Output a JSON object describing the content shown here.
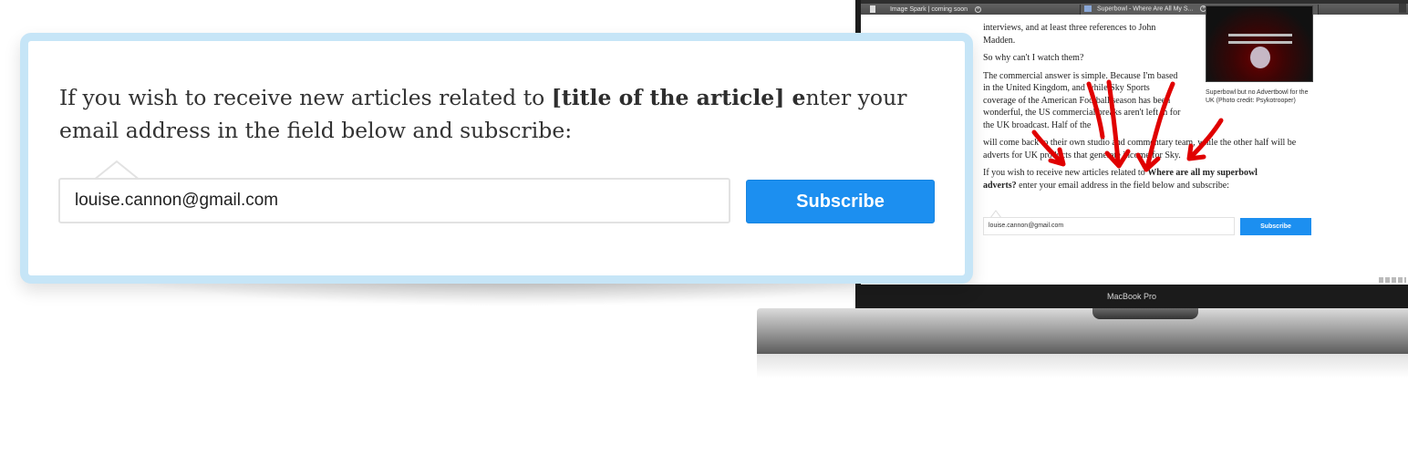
{
  "browser": {
    "tabs": [
      {
        "label": "Image Spark | coming soon"
      },
      {
        "label": "Superbowl - Where Are All My S..."
      }
    ]
  },
  "article": {
    "p1": "interviews, and at least three references to John Madden.",
    "p2": "So why can't I watch them?",
    "p3": "The commercial answer is simple. Because I'm based in the United Kingdom, and while Sky Sports coverage of the American Football season has been wonderful, the US commercial breaks aren't left in for the UK broadcast. Half of the",
    "p4": "will come back to their own studio and commentary team, while the other half will be adverts for UK products that generate income for Sky.",
    "subscribe_prefix": "If you wish to receive new articles related to ",
    "subscribe_title": "Where are all my superbowl adverts?",
    "subscribe_suffix": " enter your email address in the field below and subscribe:",
    "photo_caption": "Superbowl but no Advertbowl for the UK (Photo credit: Psykotrooper)"
  },
  "mini_form": {
    "email_value": "louise.cannon@gmail.com",
    "button_label": "Subscribe"
  },
  "laptop": {
    "bezel_label": "MacBook Pro"
  },
  "callout": {
    "text_prefix": "If you wish to receive new articles related to ",
    "text_bold": "[title of the article] e",
    "text_suffix": "nter your email address in the field below and subscribe:",
    "email_value": "louise.cannon@gmail.com",
    "button_label": "Subscribe"
  },
  "colors": {
    "accent_blue": "#1c8ff0",
    "callout_border": "#c6e5f7",
    "annotation_red": "#e00000"
  },
  "icons": [
    "document-icon",
    "tab-close-icon",
    "favicon-icon",
    "red-arrow-annotation",
    "tray-icons"
  ]
}
